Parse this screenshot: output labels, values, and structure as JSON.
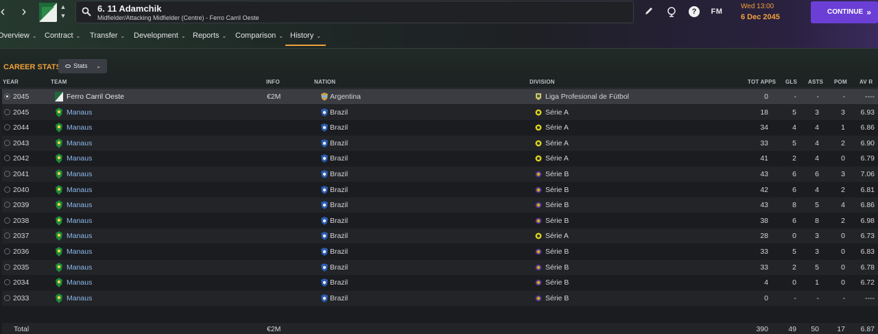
{
  "player": {
    "name": "6. 11 Adamchik",
    "subtitle": "Midfielder/Attacking Midfielder (Centre) - Ferro Carril Oeste"
  },
  "nav": {
    "back_icon": "chevron-left-icon",
    "forward_icon": "chevron-right-icon"
  },
  "toolbar": {
    "fm_label": "FM",
    "continue_label": "CONTINUE"
  },
  "date": {
    "day_time": "Wed 13:00",
    "full": "6 Dec 2045"
  },
  "tabs": [
    {
      "label": "Overview"
    },
    {
      "label": "Contract"
    },
    {
      "label": "Transfer"
    },
    {
      "label": "Development"
    },
    {
      "label": "Reports"
    },
    {
      "label": "Comparison"
    },
    {
      "label": "History"
    }
  ],
  "section": {
    "title": "CAREER STATS",
    "dropdown_label": "Stats"
  },
  "columns": {
    "year": "YEAR",
    "team": "TEAM",
    "info": "INFO",
    "nation": "NATION",
    "division": "DIVISION",
    "apps": "TOT APPS",
    "gls": "GLS",
    "asts": "ASTS",
    "pom": "POM",
    "avr": "AV R"
  },
  "rows": [
    {
      "year": "2045",
      "team": "Ferro Carril Oeste",
      "info": "€2M",
      "nation": "Argentina",
      "division": "Liga Profesional de Fútbol",
      "apps": "0",
      "gls": "-",
      "asts": "-",
      "pom": "-",
      "avr": "----"
    },
    {
      "year": "2045",
      "team": "Manaus",
      "info": "",
      "nation": "Brazil",
      "division": "Série A",
      "apps": "18",
      "gls": "5",
      "asts": "3",
      "pom": "3",
      "avr": "6.93"
    },
    {
      "year": "2044",
      "team": "Manaus",
      "info": "",
      "nation": "Brazil",
      "division": "Série A",
      "apps": "34",
      "gls": "4",
      "asts": "4",
      "pom": "1",
      "avr": "6.86"
    },
    {
      "year": "2043",
      "team": "Manaus",
      "info": "",
      "nation": "Brazil",
      "division": "Série A",
      "apps": "33",
      "gls": "5",
      "asts": "4",
      "pom": "2",
      "avr": "6.90"
    },
    {
      "year": "2042",
      "team": "Manaus",
      "info": "",
      "nation": "Brazil",
      "division": "Série A",
      "apps": "41",
      "gls": "2",
      "asts": "4",
      "pom": "0",
      "avr": "6.79"
    },
    {
      "year": "2041",
      "team": "Manaus",
      "info": "",
      "nation": "Brazil",
      "division": "Série B",
      "apps": "43",
      "gls": "6",
      "asts": "6",
      "pom": "3",
      "avr": "7.06"
    },
    {
      "year": "2040",
      "team": "Manaus",
      "info": "",
      "nation": "Brazil",
      "division": "Série B",
      "apps": "42",
      "gls": "6",
      "asts": "4",
      "pom": "2",
      "avr": "6.81"
    },
    {
      "year": "2039",
      "team": "Manaus",
      "info": "",
      "nation": "Brazil",
      "division": "Série B",
      "apps": "43",
      "gls": "8",
      "asts": "5",
      "pom": "4",
      "avr": "6.86"
    },
    {
      "year": "2038",
      "team": "Manaus",
      "info": "",
      "nation": "Brazil",
      "division": "Série B",
      "apps": "38",
      "gls": "6",
      "asts": "8",
      "pom": "2",
      "avr": "6.98"
    },
    {
      "year": "2037",
      "team": "Manaus",
      "info": "",
      "nation": "Brazil",
      "division": "Série A",
      "apps": "28",
      "gls": "0",
      "asts": "3",
      "pom": "0",
      "avr": "6.73"
    },
    {
      "year": "2036",
      "team": "Manaus",
      "info": "",
      "nation": "Brazil",
      "division": "Série B",
      "apps": "33",
      "gls": "5",
      "asts": "3",
      "pom": "0",
      "avr": "6.83"
    },
    {
      "year": "2035",
      "team": "Manaus",
      "info": "",
      "nation": "Brazil",
      "division": "Série B",
      "apps": "33",
      "gls": "2",
      "asts": "5",
      "pom": "0",
      "avr": "6.78"
    },
    {
      "year": "2034",
      "team": "Manaus",
      "info": "",
      "nation": "Brazil",
      "division": "Série B",
      "apps": "4",
      "gls": "0",
      "asts": "1",
      "pom": "0",
      "avr": "6.72"
    },
    {
      "year": "2033",
      "team": "Manaus",
      "info": "",
      "nation": "Brazil",
      "division": "Série B",
      "apps": "0",
      "gls": "-",
      "asts": "-",
      "pom": "-",
      "avr": "----"
    }
  ],
  "total": {
    "label": "Total",
    "info": "€2M",
    "apps": "390",
    "gls": "49",
    "asts": "50",
    "pom": "17",
    "avr": "6.87"
  },
  "colors": {
    "accent_orange": "#f0a13a",
    "continue_purple": "#6b3fd6",
    "link_blue": "#8cb9ea",
    "serie_a_yellow": "#d8d11e",
    "serie_b_gold": "#c9a227",
    "manaus_green": "#1f8a3a",
    "brazil_blue": "#2a5db0"
  }
}
